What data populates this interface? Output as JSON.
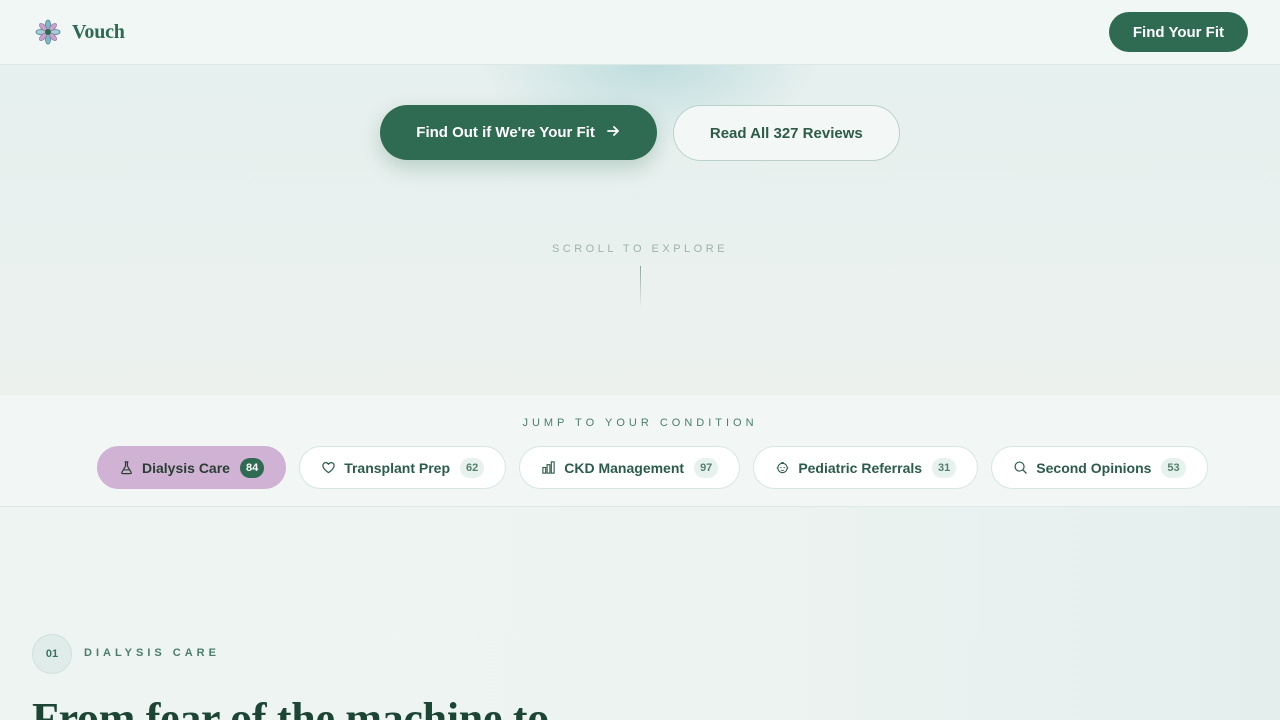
{
  "header": {
    "brand": "Vouch",
    "logo_icon": "flower-icon",
    "cta_label": "Find Your Fit"
  },
  "hero": {
    "primary_button": "Find Out if We're Your Fit",
    "primary_icon": "arrow-right-icon",
    "secondary_button": "Read All 327 Reviews",
    "scroll_hint": "SCROLL TO EXPLORE"
  },
  "conditions": {
    "title": "JUMP TO YOUR CONDITION",
    "chips": [
      {
        "label": "Dialysis Care",
        "count": "84",
        "icon": "flask-icon",
        "active": true
      },
      {
        "label": "Transplant Prep",
        "count": "62",
        "icon": "heart-icon",
        "active": false
      },
      {
        "label": "CKD Management",
        "count": "97",
        "icon": "bar-chart-icon",
        "active": false
      },
      {
        "label": "Pediatric Referrals",
        "count": "31",
        "icon": "baby-icon",
        "active": false
      },
      {
        "label": "Second Opinions",
        "count": "53",
        "icon": "search-icon",
        "active": false
      }
    ]
  },
  "section": {
    "number": "01",
    "label": "DIALYSIS CARE",
    "heading": "From fear of the machine to"
  },
  "colors": {
    "primary": "#2e6b52",
    "active_chip": "#cfb2d4",
    "background": "#eef4f2"
  }
}
